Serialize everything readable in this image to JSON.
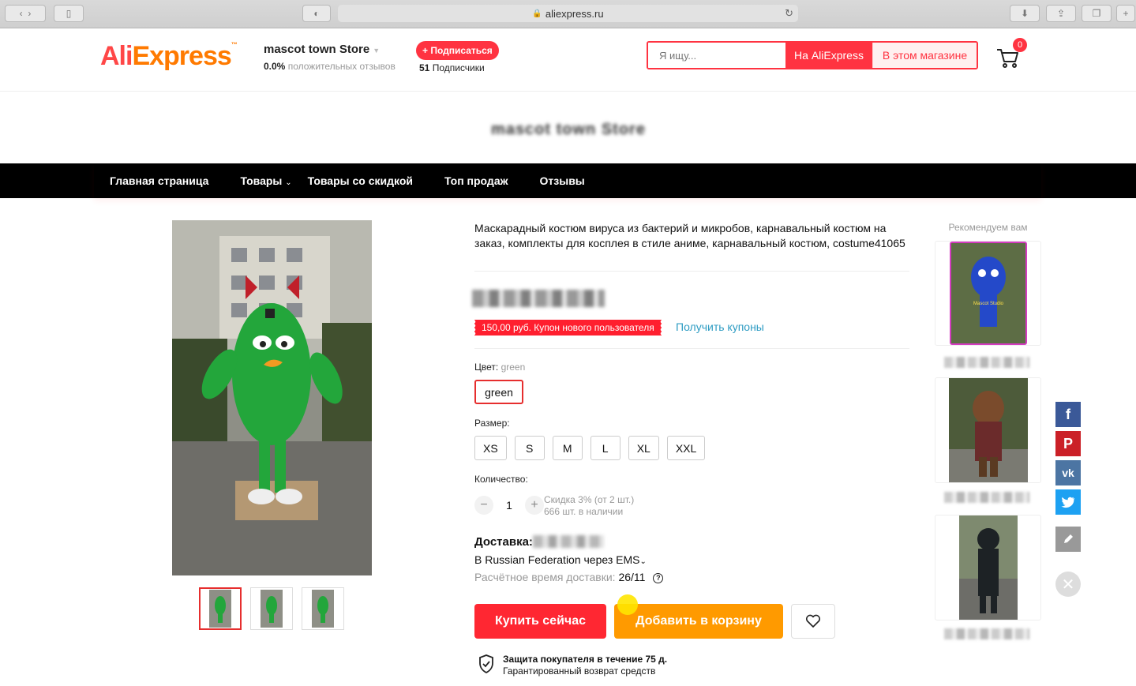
{
  "browser": {
    "url": "aliexpress.ru"
  },
  "header": {
    "logo_ali": "Ali",
    "logo_express": "Express",
    "store_name": "mascot town Store",
    "rating_value": "0.0%",
    "rating_label": "положительных отзывов",
    "subscribe_label": "+ Подписаться",
    "subscribers_count": "51",
    "subscribers_label": "Подписчики",
    "search_placeholder": "Я ищу...",
    "search_all_label": "На AliExpress",
    "search_store_label": "В этом магазине",
    "cart_count": "0"
  },
  "banner": {
    "store_title": "mascot town Store"
  },
  "nav": {
    "items": [
      {
        "label": "Главная страница"
      },
      {
        "label": "Товары"
      },
      {
        "label": "Товары со скидкой"
      },
      {
        "label": "Топ продаж"
      },
      {
        "label": "Отзывы"
      }
    ]
  },
  "product": {
    "title": "Маскарадный костюм вируса из бактерий и микробов, карнавальный костюм на заказ, комплекты для косплея в стиле аниме, карнавальный костюм, costume41065",
    "coupon_tag": "150,00 руб. Купон нового пользователя",
    "coupon_link": "Получить купоны",
    "color_label": "Цвет:",
    "color_selected": "green",
    "color_option": "green",
    "size_label": "Размер:",
    "sizes": [
      "XS",
      "S",
      "M",
      "L",
      "XL",
      "XXL"
    ],
    "quantity_label": "Количество:",
    "quantity_value": "1",
    "discount_text": "Скидка 3% (от 2 шт.)",
    "stock_text": "666 шт. в наличии",
    "shipping_label": "Доставка:",
    "shipping_method": "В Russian Federation через EMS",
    "delivery_time_label": "Расчётное время доставки:",
    "delivery_time_value": "26/11",
    "buy_now": "Купить сейчас",
    "add_to_cart": "Добавить в корзину",
    "protection_title": "Защита покупателя в течение 75 д.",
    "protection_sub": "Гарантированный возврат средств"
  },
  "recommend": {
    "title": "Рекомендуем вам"
  },
  "colors": {
    "brand_red": "#ff3341",
    "buy_red": "#ff2732",
    "cart_orange": "#ff9a00",
    "link_blue": "#2e9cc3",
    "facebook": "#3b5998",
    "pinterest": "#cb2027",
    "vk": "#4c75a3",
    "twitter": "#1da1f2"
  },
  "share_icons": [
    "facebook-icon",
    "pinterest-icon",
    "vk-icon",
    "twitter-icon",
    "pencil-icon",
    "close-icon"
  ]
}
